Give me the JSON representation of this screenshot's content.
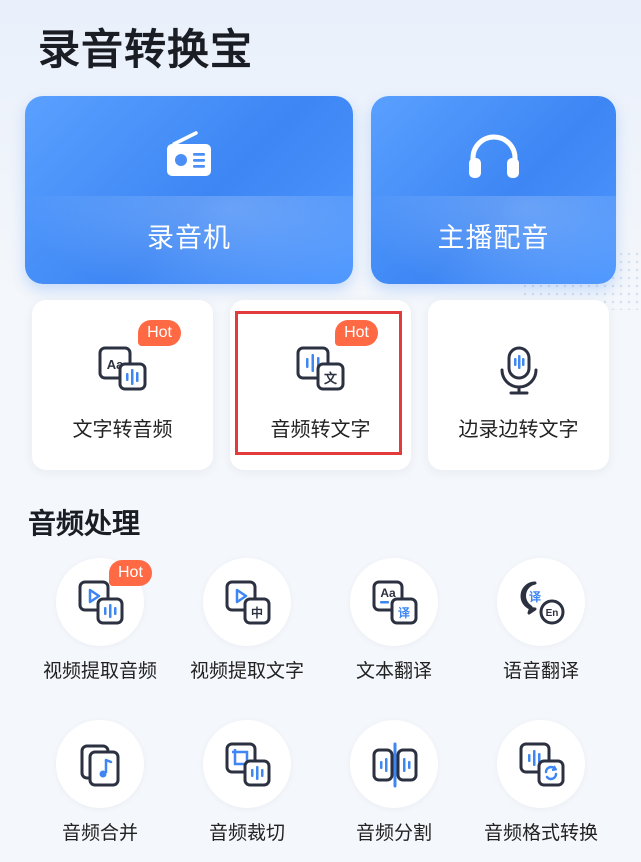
{
  "app": {
    "title": "录音转换宝"
  },
  "big_cards": [
    {
      "label": "录音机"
    },
    {
      "label": "主播配音"
    }
  ],
  "mid_cards": [
    {
      "label": "文字转音频",
      "badge": "Hot"
    },
    {
      "label": "音频转文字",
      "badge": "Hot",
      "highlighted": true
    },
    {
      "label": "边录边转文字"
    }
  ],
  "audio_processing": {
    "title": "音频处理",
    "tools": [
      {
        "label": "视频提取音频",
        "badge": "Hot",
        "icon": "video-audio-icon"
      },
      {
        "label": "视频提取文字",
        "icon": "video-text-icon"
      },
      {
        "label": "文本翻译",
        "icon": "text-translate-icon"
      },
      {
        "label": "语音翻译",
        "icon": "voice-translate-icon"
      },
      {
        "label": "音频合并",
        "icon": "audio-merge-icon"
      },
      {
        "label": "音频裁切",
        "icon": "audio-crop-icon"
      },
      {
        "label": "音频分割",
        "icon": "audio-split-icon"
      },
      {
        "label": "音频格式转换",
        "icon": "audio-format-icon"
      }
    ]
  },
  "colors": {
    "accent": "#3d86f4",
    "hot": "#ff6a45",
    "highlight": "#e23b3b",
    "icon_dark": "#2b3140"
  },
  "icon_glyphs": {
    "aa": "Aa",
    "wen": "文",
    "zhong": "中",
    "yi": "译",
    "en": "En"
  }
}
